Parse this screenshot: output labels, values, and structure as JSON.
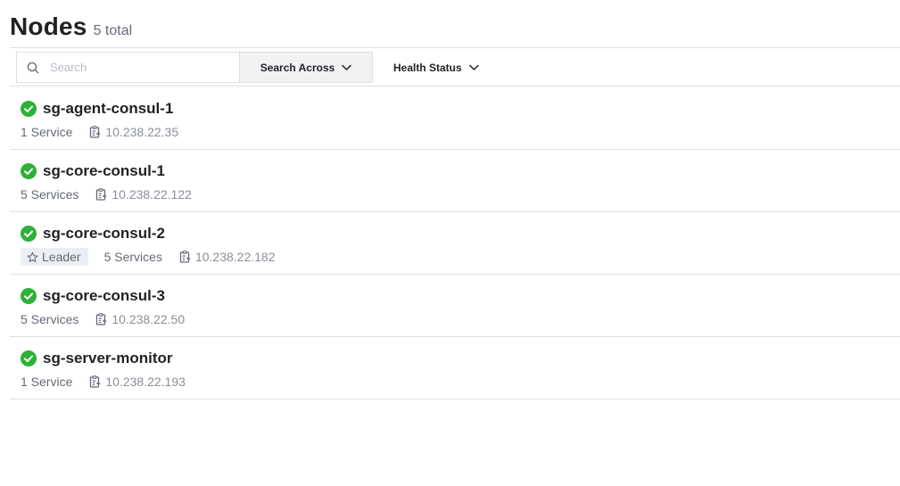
{
  "header": {
    "title": "Nodes",
    "total": "5 total"
  },
  "toolbar": {
    "search_placeholder": "Search",
    "search_across_label": "Search Across",
    "health_status_label": "Health Status"
  },
  "colors": {
    "healthy": "#2eb039",
    "text": "#1f2124",
    "muted": "#656a76",
    "border": "#dedfe3"
  },
  "nodes": [
    {
      "name": "sg-agent-consul-1",
      "leader": "",
      "services": "1 Service",
      "address": "10.238.22.35",
      "status": "passing"
    },
    {
      "name": "sg-core-consul-1",
      "leader": "",
      "services": "5 Services",
      "address": "10.238.22.122",
      "status": "passing"
    },
    {
      "name": "sg-core-consul-2",
      "leader": "Leader",
      "services": "5 Services",
      "address": "10.238.22.182",
      "status": "passing"
    },
    {
      "name": "sg-core-consul-3",
      "leader": "",
      "services": "5 Services",
      "address": "10.238.22.50",
      "status": "passing"
    },
    {
      "name": "sg-server-monitor",
      "leader": "",
      "services": "1 Service",
      "address": "10.238.22.193",
      "status": "passing"
    }
  ]
}
